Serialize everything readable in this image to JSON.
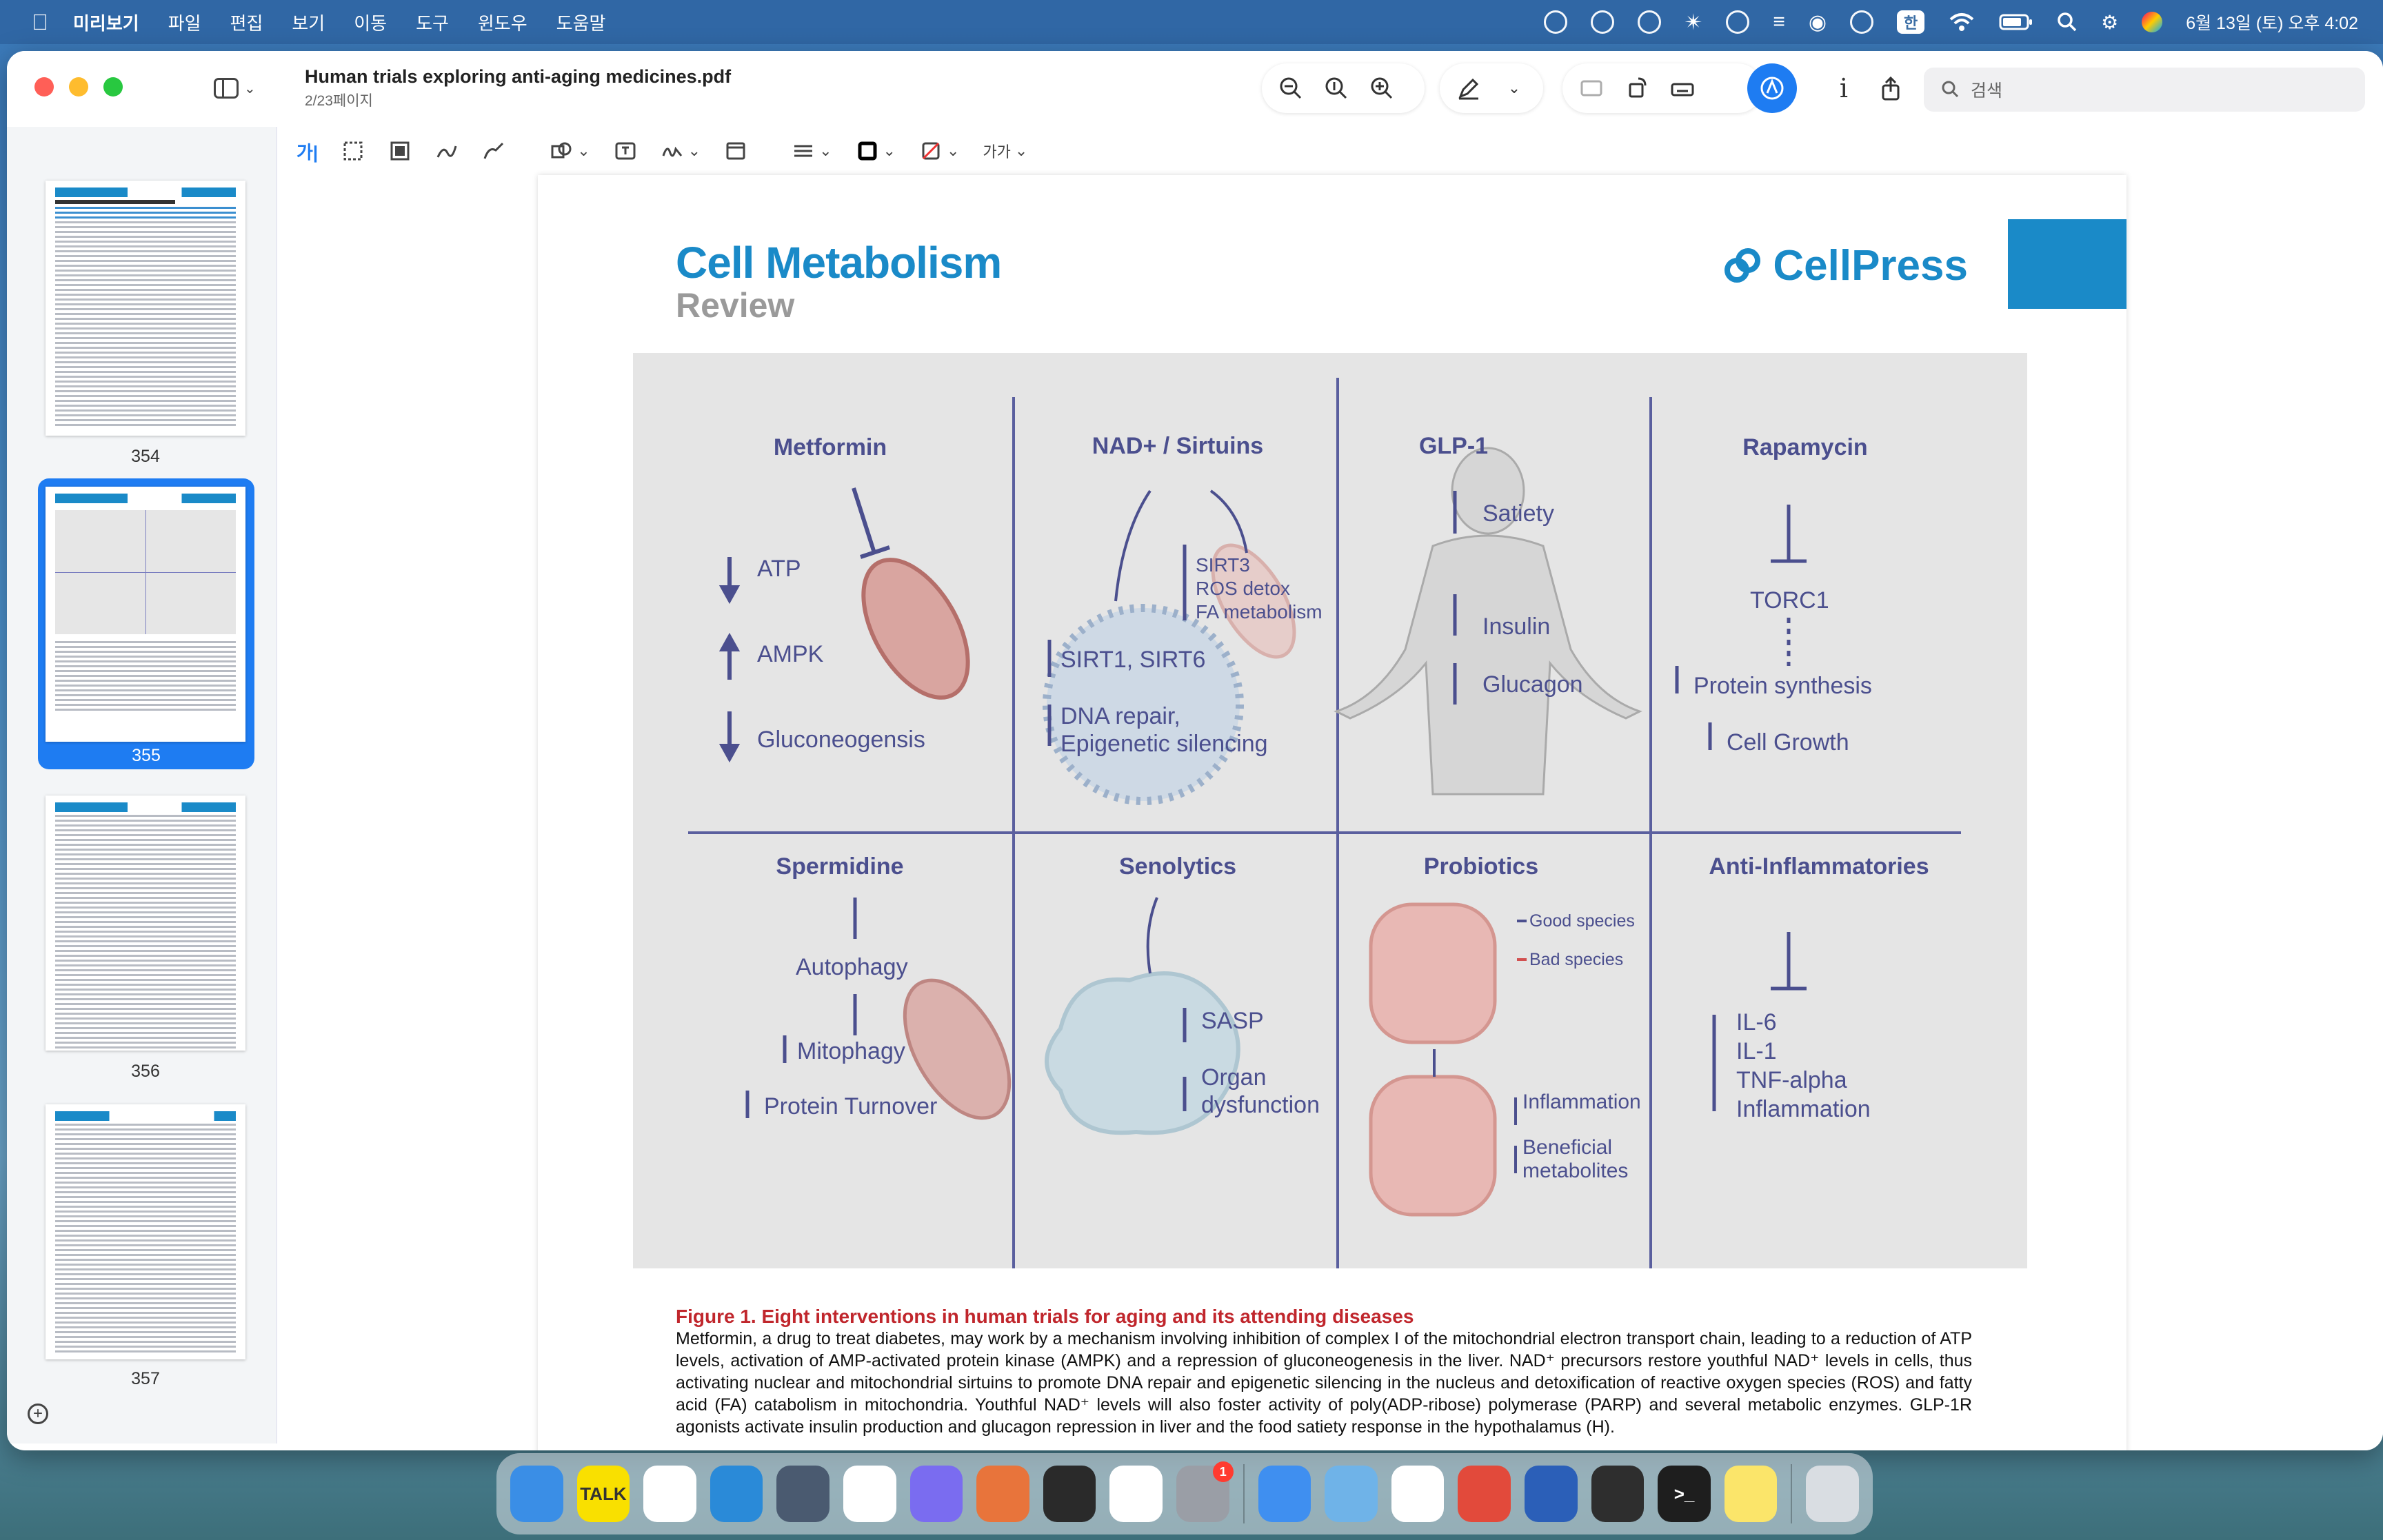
{
  "menubar": {
    "app": "미리보기",
    "items": [
      "파일",
      "편집",
      "보기",
      "이동",
      "도구",
      "윈도우",
      "도움말"
    ],
    "input_indicator": "한",
    "datetime": "6월 13일 (토) 오후 4:02"
  },
  "window": {
    "title": "Human trials exploring anti-aging medicines.pdf",
    "page_info": "2/23페이지",
    "search_placeholder": "검색",
    "markup_text_style": "가가"
  },
  "sidebar": {
    "thumbnails": [
      {
        "label": "354",
        "selected": false
      },
      {
        "label": "355",
        "selected": true
      },
      {
        "label": "356",
        "selected": false
      },
      {
        "label": "357",
        "selected": false
      }
    ]
  },
  "page": {
    "journal": "Cell Metabolism",
    "section": "Review",
    "publisher": "CellPress",
    "figure": {
      "panels": {
        "metformin": {
          "title": "Metformin",
          "items": [
            "ATP",
            "AMPK",
            "Gluconeogensis"
          ]
        },
        "nad": {
          "title": "NAD+ / Sirtuins",
          "items": [
            "SIRT3",
            "ROS detox",
            "FA metabolism",
            "SIRT1, SIRT6",
            "DNA repair,",
            "Epigenetic silencing"
          ]
        },
        "glp1": {
          "title": "GLP-1",
          "items": [
            "Satiety",
            "Insulin",
            "Glucagon"
          ]
        },
        "rapamycin": {
          "title": "Rapamycin",
          "items": [
            "TORC1",
            "Protein synthesis",
            "Cell Growth"
          ]
        },
        "spermidine": {
          "title": "Spermidine",
          "items": [
            "Autophagy",
            "Mitophagy",
            "Protein Turnover"
          ]
        },
        "senolytics": {
          "title": "Senolytics",
          "items": [
            "SASP",
            "Organ",
            "dysfunction"
          ]
        },
        "probiotics": {
          "title": "Probiotics",
          "items": [
            "Good species",
            "Bad species",
            "Inflammation",
            "Beneficial",
            "metabolites"
          ]
        },
        "antiinflam": {
          "title": "Anti-Inflammatories",
          "items": [
            "IL-6",
            "IL-1",
            "TNF-alpha",
            "Inflammation"
          ]
        }
      }
    },
    "caption_title": "Figure 1.  Eight interventions in human trials for aging and its attending diseases",
    "caption_body": "Metformin, a drug to treat diabetes, may work by a mechanism involving inhibition of complex I of the mitochondrial electron transport chain, leading to a reduction of ATP levels, activation of AMP-activated protein kinase (AMPK) and a repression of gluconeogenesis in the liver. NAD⁺ precursors restore youthful NAD⁺ levels in cells, thus activating nuclear and mitochondrial sirtuins to promote DNA repair and epigenetic silencing in the nucleus and detoxification of reactive oxygen species (ROS) and fatty acid (FA) catabolism in mitochondria. Youthful NAD⁺ levels will also foster activity of poly(ADP-ribose) polymerase (PARP) and several metabolic enzymes. GLP-1R agonists activate insulin production and glucagon repression in liver and the food satiety response in the hypothalamus (H)."
  },
  "dock": {
    "apps": [
      {
        "name": "Finder",
        "color": "#3a8ee6",
        "label": ""
      },
      {
        "name": "KakaoTalk",
        "color": "#f9e000",
        "label": "TALK"
      },
      {
        "name": "Chrome",
        "color": "#ffffff",
        "label": ""
      },
      {
        "name": "VS Code",
        "color": "#2a8ad8",
        "label": ""
      },
      {
        "name": "Parallels",
        "color": "#4a5a70",
        "label": ""
      },
      {
        "name": "ChatGPT",
        "color": "#ffffff",
        "label": ""
      },
      {
        "name": "Messenger",
        "color": "#7a6cf0",
        "label": ""
      },
      {
        "name": "Claude",
        "color": "#e8743b",
        "label": ""
      },
      {
        "name": "Launchpad",
        "color": "#2a2a2a",
        "label": ""
      },
      {
        "name": "Perplexity",
        "color": "#ffffff",
        "label": ""
      },
      {
        "name": "System Settings",
        "color": "#9a9ea6",
        "label": "",
        "badge": "1"
      },
      {
        "name": "Mail",
        "color": "#3f8ff0",
        "label": ""
      },
      {
        "name": "Ollama",
        "color": "#6fb3e8",
        "label": ""
      },
      {
        "name": "Numbers",
        "color": "#ffffff",
        "label": ""
      },
      {
        "name": "PDF Expert",
        "color": "#e24a3b",
        "label": ""
      },
      {
        "name": "Word",
        "color": "#2b5fb8",
        "label": ""
      },
      {
        "name": "Keychain",
        "color": "#2e2e2e",
        "label": ""
      },
      {
        "name": "Terminal",
        "color": "#1e1e1e",
        "label": ">_"
      },
      {
        "name": "Notes",
        "color": "#fbe56a",
        "label": ""
      },
      {
        "name": "Trash",
        "color": "#d9dde2",
        "label": ""
      }
    ]
  }
}
